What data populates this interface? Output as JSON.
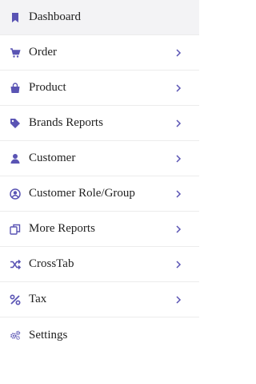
{
  "accent": "#5a54b4",
  "menu": {
    "items": [
      {
        "label": "Dashboard",
        "icon": "bookmark-icon",
        "has_chevron": false,
        "active": true
      },
      {
        "label": "Order",
        "icon": "cart-icon",
        "has_chevron": true
      },
      {
        "label": "Product",
        "icon": "shopping-bag-icon",
        "has_chevron": true
      },
      {
        "label": "Brands Reports",
        "icon": "tag-icon",
        "has_chevron": true
      },
      {
        "label": "Customer",
        "icon": "user-icon",
        "has_chevron": true
      },
      {
        "label": "Customer Role/Group",
        "icon": "user-circle-icon",
        "has_chevron": true
      },
      {
        "label": "More Reports",
        "icon": "copy-icon",
        "has_chevron": true
      },
      {
        "label": "CrossTab",
        "icon": "shuffle-icon",
        "has_chevron": true
      },
      {
        "label": "Tax",
        "icon": "percent-icon",
        "has_chevron": true
      },
      {
        "label": "Settings",
        "icon": "gears-icon",
        "has_chevron": false
      }
    ]
  }
}
